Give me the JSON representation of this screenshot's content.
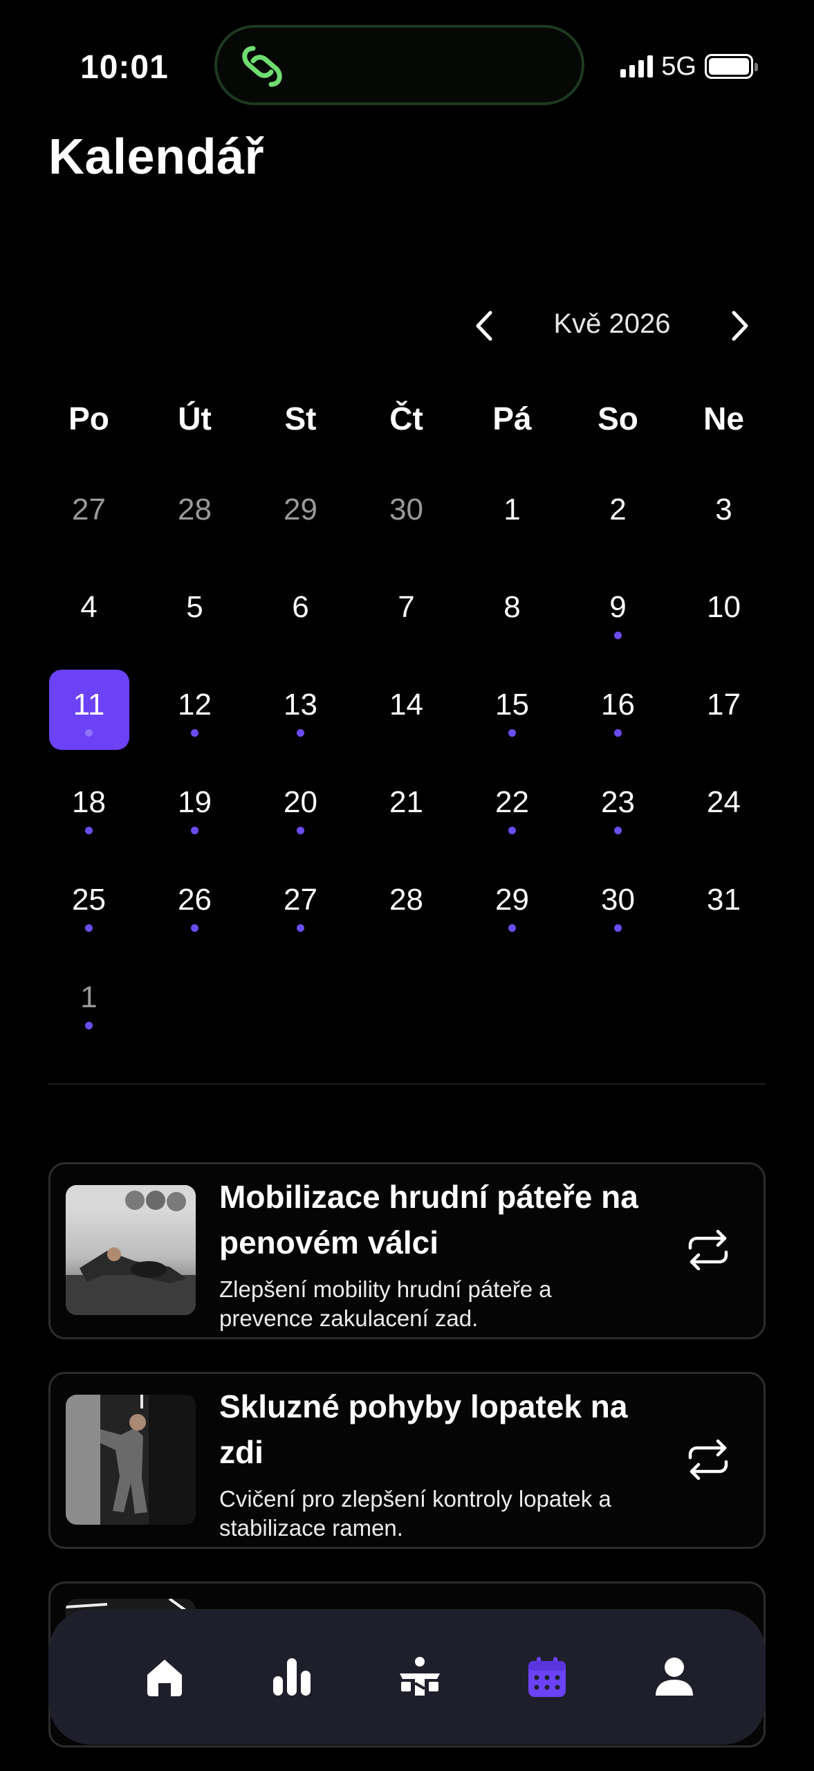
{
  "status_bar": {
    "time": "10:01",
    "network": "5G",
    "battery_level": 1.0
  },
  "page": {
    "title": "Kalendář"
  },
  "calendar": {
    "month_label": "Kvě 2026",
    "weekdays": [
      "Po",
      "Út",
      "St",
      "Čt",
      "Pá",
      "So",
      "Ne"
    ],
    "accent_color": "#6b42f5",
    "dot_color": "#6a4cf0",
    "days": [
      {
        "label": "27",
        "other": true,
        "dot": false
      },
      {
        "label": "28",
        "other": true,
        "dot": false
      },
      {
        "label": "29",
        "other": true,
        "dot": false
      },
      {
        "label": "30",
        "other": true,
        "dot": false
      },
      {
        "label": "1",
        "other": false,
        "dot": false
      },
      {
        "label": "2",
        "other": false,
        "dot": false
      },
      {
        "label": "3",
        "other": false,
        "dot": false
      },
      {
        "label": "4",
        "other": false,
        "dot": false
      },
      {
        "label": "5",
        "other": false,
        "dot": false
      },
      {
        "label": "6",
        "other": false,
        "dot": false
      },
      {
        "label": "7",
        "other": false,
        "dot": false
      },
      {
        "label": "8",
        "other": false,
        "dot": false
      },
      {
        "label": "9",
        "other": false,
        "dot": true
      },
      {
        "label": "10",
        "other": false,
        "dot": false
      },
      {
        "label": "11",
        "other": false,
        "dot": true,
        "selected": true
      },
      {
        "label": "12",
        "other": false,
        "dot": true
      },
      {
        "label": "13",
        "other": false,
        "dot": true
      },
      {
        "label": "14",
        "other": false,
        "dot": false
      },
      {
        "label": "15",
        "other": false,
        "dot": true
      },
      {
        "label": "16",
        "other": false,
        "dot": true
      },
      {
        "label": "17",
        "other": false,
        "dot": false
      },
      {
        "label": "18",
        "other": false,
        "dot": true
      },
      {
        "label": "19",
        "other": false,
        "dot": true
      },
      {
        "label": "20",
        "other": false,
        "dot": true
      },
      {
        "label": "21",
        "other": false,
        "dot": false
      },
      {
        "label": "22",
        "other": false,
        "dot": true
      },
      {
        "label": "23",
        "other": false,
        "dot": true
      },
      {
        "label": "24",
        "other": false,
        "dot": false
      },
      {
        "label": "25",
        "other": false,
        "dot": true
      },
      {
        "label": "26",
        "other": false,
        "dot": true
      },
      {
        "label": "27",
        "other": false,
        "dot": true
      },
      {
        "label": "28",
        "other": false,
        "dot": false
      },
      {
        "label": "29",
        "other": false,
        "dot": true
      },
      {
        "label": "30",
        "other": false,
        "dot": true
      },
      {
        "label": "31",
        "other": false,
        "dot": false
      },
      {
        "label": "1",
        "other": true,
        "dot": true
      }
    ]
  },
  "exercises": [
    {
      "title": "Mobilizace hrudní páteře na penovém válci",
      "description": "Zlepšení mobility hrudní páteře a prevence zakulacení zad.",
      "thumb_icon": "foam-roller-photo"
    },
    {
      "title": "Skluzné pohyby lopatek na zdi",
      "description": "Cvičení pro zlepšení kontroly lopatek a stabilizace ramen.",
      "thumb_icon": "wall-slide-photo"
    }
  ],
  "bottom_nav": {
    "items": [
      {
        "icon": "home-icon",
        "active": false
      },
      {
        "icon": "stats-icon",
        "active": false
      },
      {
        "icon": "workout-icon",
        "active": false
      },
      {
        "icon": "calendar-icon",
        "active": true
      },
      {
        "icon": "profile-icon",
        "active": false
      }
    ],
    "active_color": "#6b42f5",
    "inactive_color": "#ffffff"
  }
}
